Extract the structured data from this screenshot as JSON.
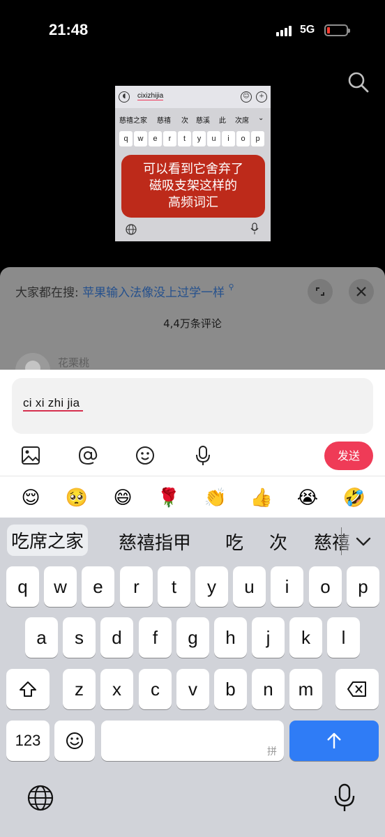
{
  "status": {
    "time": "21:48",
    "network": "5G",
    "battery_level": 0.15,
    "battery_color": "#ff3b30"
  },
  "video": {
    "input_text": "cixizhijia",
    "candidates": [
      "慈禧之家",
      "慈禧",
      "次",
      "慈溪",
      "此",
      "次席"
    ],
    "keys": [
      "q",
      "w",
      "e",
      "r",
      "t",
      "y",
      "u",
      "i",
      "o",
      "p"
    ],
    "caption": "可以看到它舍弃了\n磁吸支架这样的\n高频词汇",
    "caption_color": "#bd2a1a"
  },
  "sheet": {
    "hint_prefix": "大家都在搜:",
    "hint_link": "苹果输入法像没上过学一样",
    "comment_count": "4,4万条评论",
    "commenter_name": "花栗桃"
  },
  "composer": {
    "input_text": "ci xi zhi jia",
    "send_label": "发送",
    "send_color": "#ef3b57",
    "tools": [
      "image-icon",
      "mention-icon",
      "emoji-icon",
      "voice-icon"
    ],
    "quick_emojis": [
      "😌",
      "🥺",
      "😄",
      "🌹",
      "👏",
      "👍",
      "😭",
      "🤣"
    ]
  },
  "keyboard": {
    "candidates": [
      "吃席之家",
      "慈禧指甲",
      "吃",
      "次",
      "慈禧"
    ],
    "row1": [
      "q",
      "w",
      "e",
      "r",
      "t",
      "y",
      "u",
      "i",
      "o",
      "p"
    ],
    "row2": [
      "a",
      "s",
      "d",
      "f",
      "g",
      "h",
      "j",
      "k",
      "l"
    ],
    "row3": [
      "z",
      "x",
      "c",
      "v",
      "b",
      "n",
      "m"
    ],
    "num_label": "123",
    "space_tag": "拼",
    "return_color": "#2f7cf6"
  }
}
